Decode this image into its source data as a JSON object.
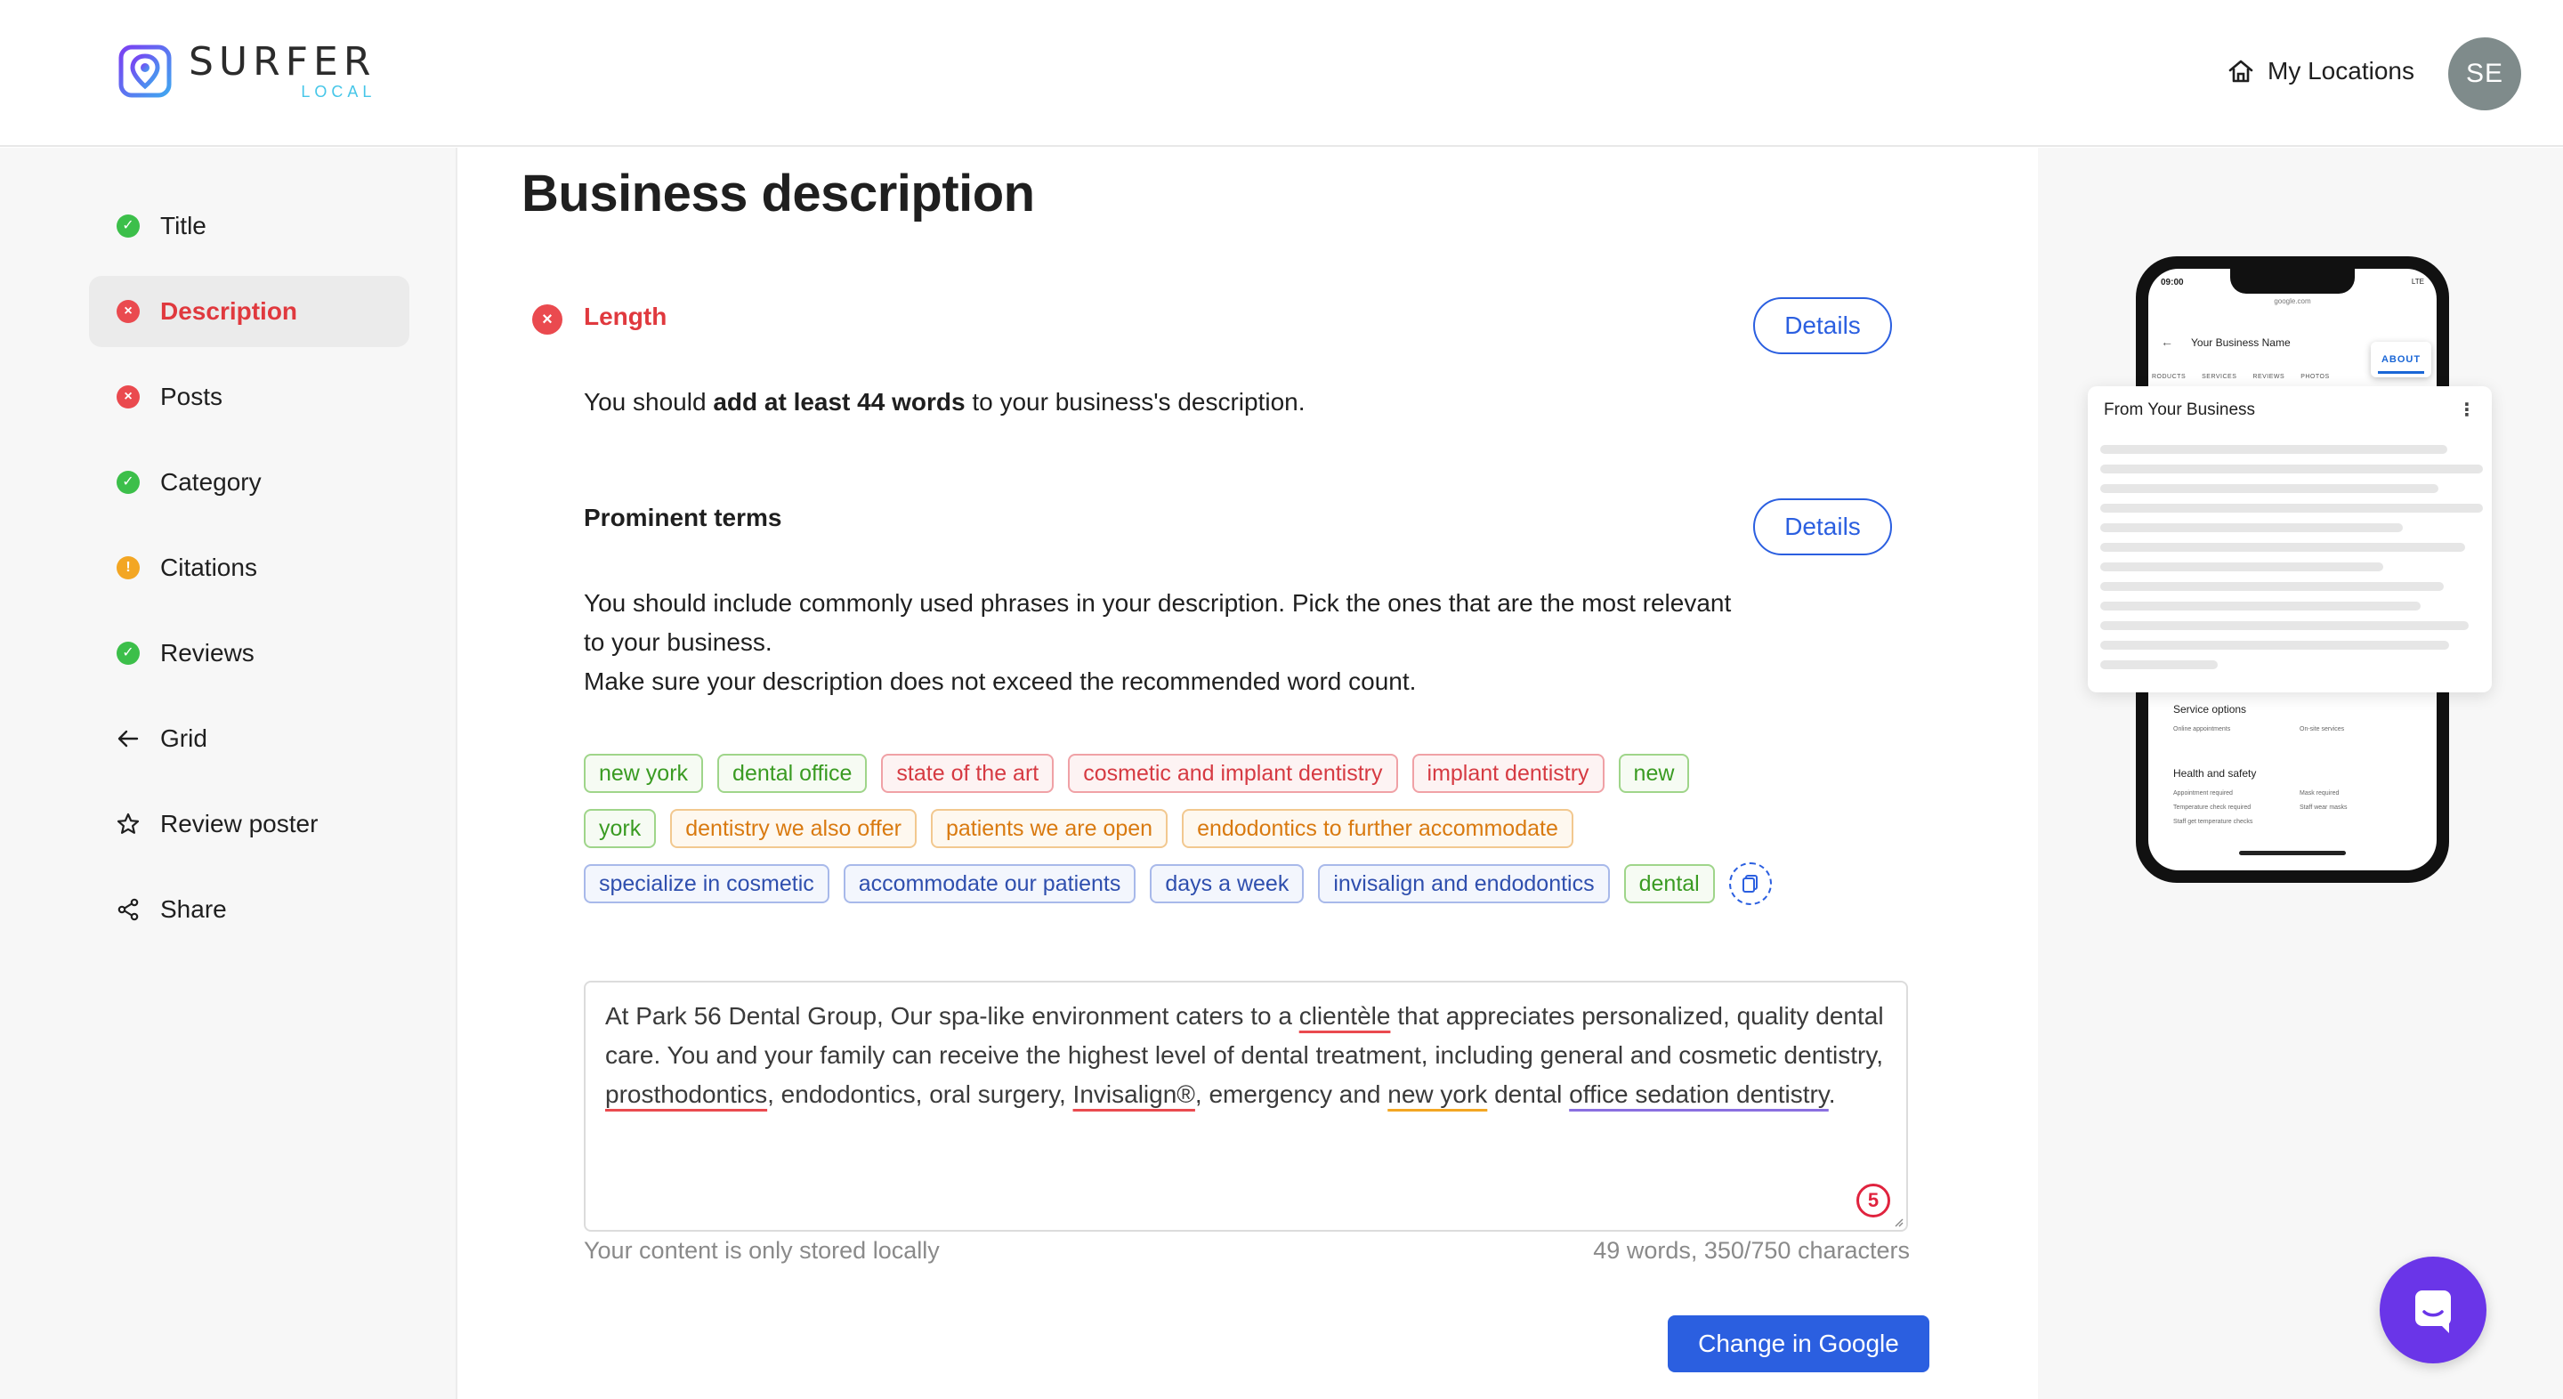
{
  "header": {
    "logo_word": "SURFER",
    "logo_sub": "LOCAL",
    "my_locations_label": "My Locations",
    "avatar_initials": "SE"
  },
  "sidebar": {
    "items": [
      {
        "label": "Title",
        "status": "green"
      },
      {
        "label": "Description",
        "status": "red",
        "active": true
      },
      {
        "label": "Posts",
        "status": "red"
      },
      {
        "label": "Category",
        "status": "green"
      },
      {
        "label": "Citations",
        "status": "orange"
      },
      {
        "label": "Reviews",
        "status": "green"
      },
      {
        "label": "Grid",
        "icon": "arrow-left-icon"
      },
      {
        "label": "Review poster",
        "icon": "star-icon"
      },
      {
        "label": "Share",
        "icon": "share-icon"
      }
    ]
  },
  "main": {
    "title": "Business description",
    "length": {
      "title": "Length",
      "details_label": "Details",
      "text_pre": "You should ",
      "text_bold": "add at least 44 words",
      "text_post": " to your business's description."
    },
    "terms": {
      "title": "Prominent terms",
      "details_label": "Details",
      "line1": "You should include commonly used phrases in your description. Pick the ones that are the most relevant",
      "line2": "to your business.",
      "line3": "Make sure your description does not exceed the recommended word count."
    },
    "chips": [
      [
        {
          "label": "new york",
          "color": "green"
        },
        {
          "label": "dental office",
          "color": "green"
        },
        {
          "label": "state of the art",
          "color": "red"
        },
        {
          "label": "cosmetic and implant dentistry",
          "color": "red"
        },
        {
          "label": "implant dentistry",
          "color": "red"
        },
        {
          "label": "new",
          "color": "green"
        }
      ],
      [
        {
          "label": "york",
          "color": "green"
        },
        {
          "label": "dentistry we also offer",
          "color": "orange"
        },
        {
          "label": "patients we are open",
          "color": "orange"
        },
        {
          "label": "endodontics to further accommodate",
          "color": "orange"
        }
      ],
      [
        {
          "label": "specialize in cosmetic",
          "color": "blue"
        },
        {
          "label": "accommodate our patients",
          "color": "blue"
        },
        {
          "label": "days a week",
          "color": "blue"
        },
        {
          "label": "invisalign and endodontics",
          "color": "blue"
        },
        {
          "label": "dental",
          "color": "green"
        }
      ]
    ],
    "description": {
      "p1": "At Park 56 Dental Group, Our spa-like environment caters to a ",
      "u1": "clientèle",
      "p2": " that appreciates personalized, quality dental care. You and your family can receive the highest level of dental treatment, including general and cosmetic dentistry, ",
      "u2": "prosthodontics",
      "p3": ", endodontics, oral surgery, ",
      "u3": "Invisalign®",
      "p4": ", emergency and ",
      "u4": "new york",
      "p5": " dental ",
      "u5": "office sedation dentistry",
      "p6": ".",
      "badge_count": "5"
    },
    "storage_note": "Your content is only stored locally",
    "word_count": "49 words, 350/750 characters",
    "primary_button": "Change in Google"
  },
  "preview": {
    "time": "09:00",
    "signal": "LTE",
    "url": "google.com",
    "business_name": "Your Business Name",
    "tabs": [
      "RODUCTS",
      "SERVICES",
      "REVIEWS",
      "PHOTOS"
    ],
    "about_tab": "ABOUT",
    "card_title": "From Your Business",
    "service_options": "Service options",
    "service_items": [
      "Online appointments",
      "On-site services"
    ],
    "health_safety": "Health and safety",
    "health_items": [
      "Appointment required",
      "Mask required",
      "Temperature check required",
      "Staff wear masks",
      "Staff get temperature checks"
    ]
  },
  "colors": {
    "accent_blue": "#2b5fe0",
    "error_red": "#ea4a4f",
    "success_green": "#3cbf4a",
    "warning_orange": "#f3a623",
    "chat_purple": "#6a35e8"
  }
}
